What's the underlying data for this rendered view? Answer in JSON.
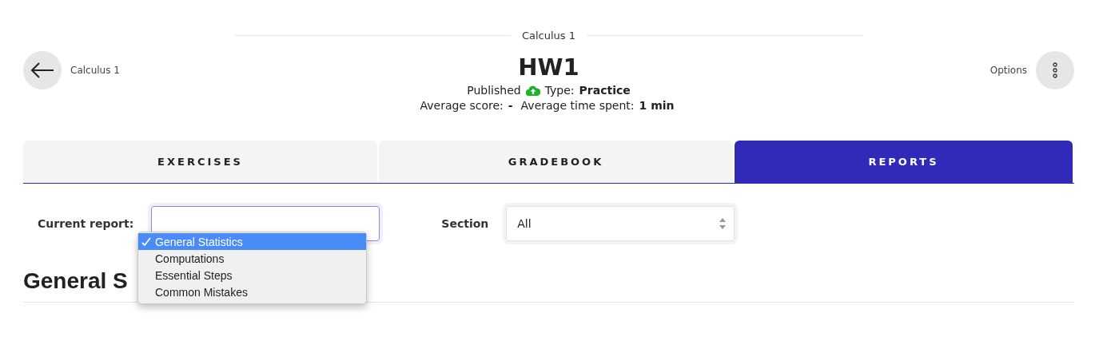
{
  "breadcrumb": "Calculus 1",
  "back": {
    "label": "Calculus 1"
  },
  "title": "HW1",
  "status": {
    "label": "Published"
  },
  "type": {
    "label": "Type:",
    "value": "Practice"
  },
  "stats": [
    {
      "label": "Average score:",
      "value": "-"
    },
    {
      "label": "Average time spent:",
      "value": "1 min"
    }
  ],
  "options": {
    "label": "Options"
  },
  "tabs": [
    {
      "label": "EXERCISES",
      "selected": false
    },
    {
      "label": "GRADEBOOK",
      "selected": false
    },
    {
      "label": "REPORTS",
      "selected": true
    }
  ],
  "report": {
    "label": "Current report:",
    "open": true,
    "options": [
      {
        "label": "General Statistics",
        "selected": true
      },
      {
        "label": "Computations",
        "selected": false
      },
      {
        "label": "Essential Steps",
        "selected": false
      },
      {
        "label": "Common Mistakes",
        "selected": false
      }
    ]
  },
  "section": {
    "label": "Section",
    "value": "All"
  },
  "heading": "General S"
}
